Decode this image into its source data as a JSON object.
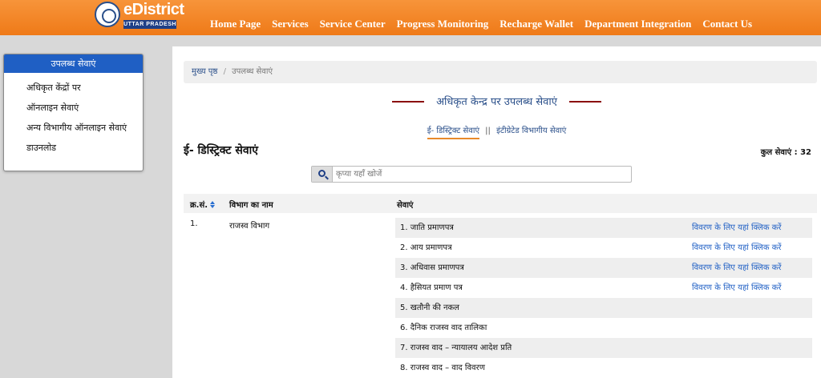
{
  "brand": {
    "name": "eDistrict",
    "sub": "UTTAR PRADESH",
    "emblem_text": "DEO"
  },
  "nav": [
    "Home Page",
    "Services",
    "Service Center",
    "Progress Monitoring",
    "Recharge Wallet",
    "Department Integration",
    "Contact Us"
  ],
  "sidebar": {
    "title": "उपलब्ध सेवाएं",
    "items": [
      "अधिकृत केंद्रों पर",
      "ऑनलाइन सेवाएं",
      "अन्य विभागीय ऑनलाइन सेवाएं",
      "डाउनलोड"
    ]
  },
  "breadcrumb": {
    "home": "मुख्य पृष्ठ",
    "separator": "/",
    "current": "उपलब्ध सेवाएं"
  },
  "page_heading": "अधिकृत केन्द्र पर उपलब्ध सेवाएं",
  "tabs": {
    "active": "ई- डिस्ट्रिक्ट सेवाएं",
    "separator": "||",
    "other": "इंटीग्रेटेड विभागीय सेवाएं"
  },
  "section_title": "ई- डिस्ट्रिक्ट सेवाएं",
  "total_services": "कुल सेवाएं : 32",
  "search": {
    "placeholder": "कृप्या यहाँ खोजें",
    "value": ""
  },
  "table": {
    "headers": [
      "क्र.सं.",
      "विभाग का नाम",
      "सेवाएं"
    ],
    "department": {
      "sno": "1.",
      "name": "राजस्व विभाग"
    },
    "detail_link_label": "विवरण के लिए यहां क्लिक करें",
    "services": [
      {
        "label": "1. जाति प्रमाणपत्र",
        "link": "विवरण के लिए यहां क्लिक करें"
      },
      {
        "label": "2. आय प्रमाणपत्र",
        "link": "विवरण के लिए यहां क्लिक करें"
      },
      {
        "label": "3. अधिवास प्रमाणपत्र",
        "link": "विवरण के लिए यहां क्लिक करें"
      },
      {
        "label": "4. हैसियत प्रमाण पत्र",
        "link": "विवरण के लिए यहां क्लिक करें"
      },
      {
        "label": "5. खतौनी की नकल",
        "link": ""
      },
      {
        "label": "6. दैनिक राजस्व वाद तालिका",
        "link": ""
      },
      {
        "label": "7. राजस्व वाद – न्यायालय आदेश प्रति",
        "link": ""
      },
      {
        "label": "8. राजस्व वाद – वाद विवरण",
        "link": ""
      }
    ]
  },
  "colors": {
    "header_orange": "#f08524",
    "brand_blue": "#1f3f86",
    "sidebar_blue": "#1f5fc4",
    "heading_line": "#8b0d0d",
    "link": "#1f5fc4"
  }
}
